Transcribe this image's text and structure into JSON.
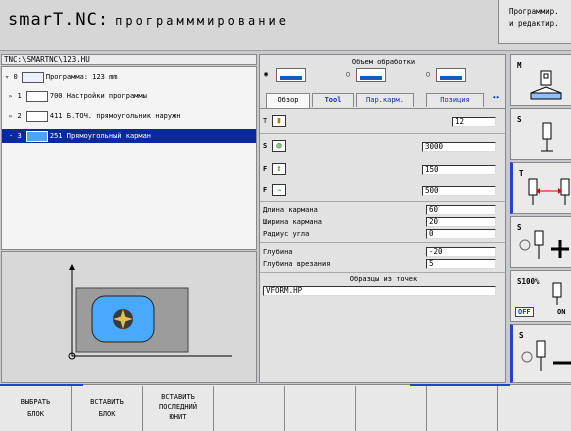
{
  "header": {
    "title": "smarT.NC:",
    "subtitle": "программмирование",
    "mode_line1": "Программир.",
    "mode_line2": "и редактир."
  },
  "tree": {
    "path": "TNC:\\SMARTNC\\123.HU",
    "items": [
      {
        "index": "0",
        "label": "Программа: 123 mm"
      },
      {
        "index": "1",
        "label": "700 Настройки программы"
      },
      {
        "index": "2",
        "label": "411 Б.ТОЧ. прямоугольник наружн"
      },
      {
        "index": "3",
        "label": "251 Прямоугольный карман"
      }
    ]
  },
  "form": {
    "scope_title": "Объем обработки",
    "tabs": [
      "Обзор",
      "Tool",
      "Пар.карм.",
      "Позиция"
    ],
    "tool_label": "T",
    "tool_value": "12",
    "s_label": "S",
    "s_value": "3000",
    "f1_label": "F",
    "f1_value": "150",
    "f2_label": "F",
    "f2_value": "500",
    "length_label": "Длина кармана",
    "length_value": "60",
    "width_label": "Ширина кармана",
    "width_value": "20",
    "radius_label": "Радиус угла",
    "radius_value": "0",
    "depth_label": "Глубина",
    "depth_value": "-20",
    "plunge_label": "Глубина врезания",
    "plunge_value": "5",
    "patterns_title": "Образцы из точек",
    "patterns_value": "VFORM.HP"
  },
  "softkeys": {
    "m": "M",
    "s1": "S",
    "t": "T",
    "s2": "S",
    "s100": "S100%",
    "s100_off": "OFF",
    "s100_on": "ON",
    "s3": "S"
  },
  "bottom": [
    {
      "line1": "ВЫБРАТЬ",
      "line2": "БЛОК"
    },
    {
      "line1": "ВСТАВИТЬ",
      "line2": "БЛОК"
    },
    {
      "line1": "ВСТАВИТЬ",
      "line2": "ПОСЛЕДНИЙ",
      "line3": "ЮНИТ"
    }
  ],
  "colors": {
    "selection": "#0a2a9c",
    "accent_blue": "#2244cc"
  }
}
